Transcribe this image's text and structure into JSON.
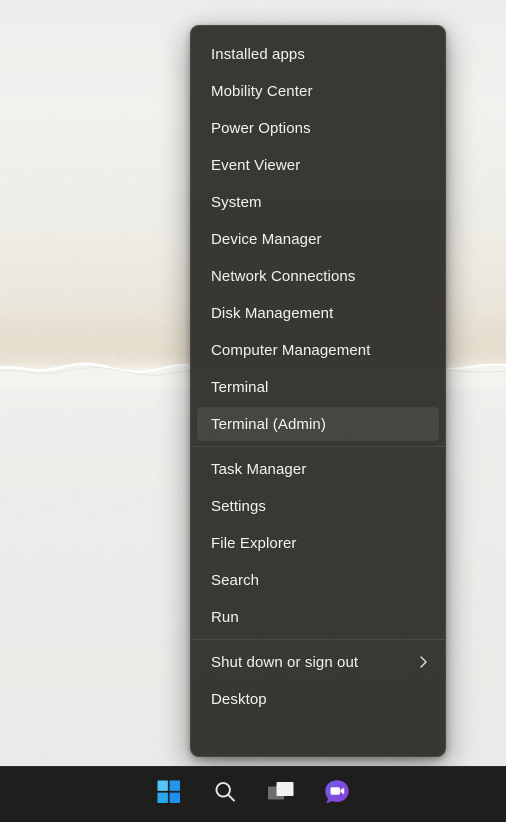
{
  "desktop": {
    "wallpaper_name": "beach-shoreline-wallpaper",
    "colors": {
      "sand_upper": "#e5ddcd",
      "foam": "#ffffff",
      "water_lower": "#eceeeb"
    }
  },
  "context_menu": {
    "name": "win-x-quick-link-menu",
    "background_color": "#30302c",
    "highlight_color": "#3d3d39",
    "text_color": "#f2f2f0",
    "groups": [
      {
        "items": [
          {
            "label": "Installed apps",
            "highlighted": false,
            "submenu": false
          },
          {
            "label": "Mobility Center",
            "highlighted": false,
            "submenu": false
          },
          {
            "label": "Power Options",
            "highlighted": false,
            "submenu": false
          },
          {
            "label": "Event Viewer",
            "highlighted": false,
            "submenu": false
          },
          {
            "label": "System",
            "highlighted": false,
            "submenu": false
          },
          {
            "label": "Device Manager",
            "highlighted": false,
            "submenu": false
          },
          {
            "label": "Network Connections",
            "highlighted": false,
            "submenu": false
          },
          {
            "label": "Disk Management",
            "highlighted": false,
            "submenu": false
          },
          {
            "label": "Computer Management",
            "highlighted": false,
            "submenu": false
          },
          {
            "label": "Terminal",
            "highlighted": false,
            "submenu": false
          },
          {
            "label": "Terminal (Admin)",
            "highlighted": true,
            "submenu": false
          }
        ]
      },
      {
        "items": [
          {
            "label": "Task Manager",
            "highlighted": false,
            "submenu": false
          },
          {
            "label": "Settings",
            "highlighted": false,
            "submenu": false
          },
          {
            "label": "File Explorer",
            "highlighted": false,
            "submenu": false
          },
          {
            "label": "Search",
            "highlighted": false,
            "submenu": false
          },
          {
            "label": "Run",
            "highlighted": false,
            "submenu": false
          }
        ]
      },
      {
        "items": [
          {
            "label": "Shut down or sign out",
            "highlighted": false,
            "submenu": true
          },
          {
            "label": "Desktop",
            "highlighted": false,
            "submenu": false
          }
        ]
      }
    ]
  },
  "taskbar": {
    "background_color": "#1e1e1e",
    "buttons": [
      {
        "icon": "windows-start-icon",
        "tooltip": "Start"
      },
      {
        "icon": "search-icon",
        "tooltip": "Search"
      },
      {
        "icon": "task-view-icon",
        "tooltip": "Task View"
      },
      {
        "icon": "chat-teams-icon",
        "tooltip": "Chat"
      }
    ],
    "icon_colors": {
      "start_blue_light": "#53bdf5",
      "start_blue": "#2194ef",
      "search_gray": "#e3e3e3",
      "task_view_front": "#f1f1f1",
      "task_view_back": "#6e6e6e",
      "chat_purple": "#7a4ee0"
    }
  }
}
